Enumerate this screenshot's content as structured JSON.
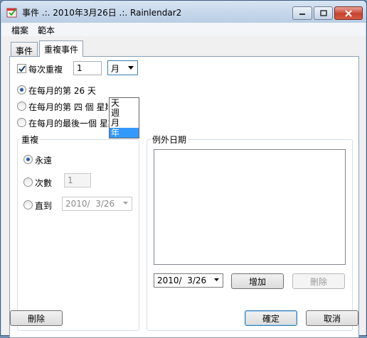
{
  "window": {
    "title": "事件 .:. 2010年3月26日 .:. Rainlendar2"
  },
  "menu": {
    "items": [
      "檔案",
      "範本"
    ]
  },
  "tabs": [
    "事件",
    "重複事件"
  ],
  "recurrence": {
    "repeat_label": "每次重複",
    "interval_value": "1",
    "unit_selected": "月",
    "unit_options": [
      "天",
      "週",
      "月",
      "年"
    ],
    "option_day_label": "在每月的第 26 天",
    "option_nth_label_visible": "在每月的第 四 個 星期",
    "option_last_label": "在每月的最後一個 星期五"
  },
  "repeat_group": {
    "title": "重複",
    "forever_label": "永遠",
    "count_label": "次數",
    "count_value": "1",
    "until_label": "直到",
    "until_date": "2010/  3/26"
  },
  "exceptions": {
    "title": "例外日期",
    "date_value": "2010/  3/26",
    "add_button": "增加",
    "remove_button": "刪除"
  },
  "footer": {
    "delete_button": "刪除",
    "ok_button": "確定",
    "cancel_button": "取消"
  },
  "colors": {
    "accent": "#3399ff",
    "close_button": "#c8432f"
  }
}
